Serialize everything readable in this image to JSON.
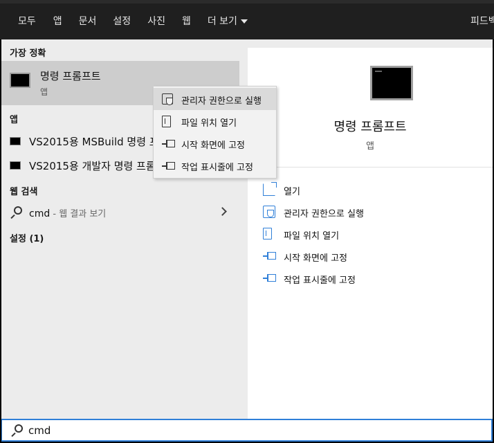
{
  "nav": {
    "tabs": [
      "모두",
      "앱",
      "문서",
      "설정",
      "사진",
      "웹",
      "더 보기"
    ],
    "active_tab": "모두",
    "feedback": "피드백"
  },
  "left": {
    "best_match_label": "가장 정확",
    "best": {
      "title": "명령 프롬프트",
      "subtitle": "앱"
    },
    "apps_label": "앱",
    "apps": [
      "VS2015용 MSBuild 명령 프롬프트",
      "VS2015용 개발자 명령 프롬프트"
    ],
    "web_label": "웹 검색",
    "web": {
      "query": "cmd",
      "hint": " - 웹 결과 보기"
    },
    "settings_label": "설정 (1)"
  },
  "context_menu": {
    "items": [
      "관리자 권한으로 실행",
      "파일 위치 열기",
      "시작 화면에 고정",
      "작업 표시줄에 고정"
    ],
    "highlighted": "관리자 권한으로 실행"
  },
  "right": {
    "title": "명령 프롬프트",
    "subtitle": "앱",
    "actions": [
      "열기",
      "관리자 권한으로 실행",
      "파일 위치 열기",
      "시작 화면에 고정",
      "작업 표시줄에 고정"
    ]
  },
  "search": {
    "value": "cmd"
  },
  "colors": {
    "accent": "#2f7fd8",
    "topbar": "#1f1f1f",
    "panel": "#ececec",
    "selected": "#cdcdcd"
  }
}
